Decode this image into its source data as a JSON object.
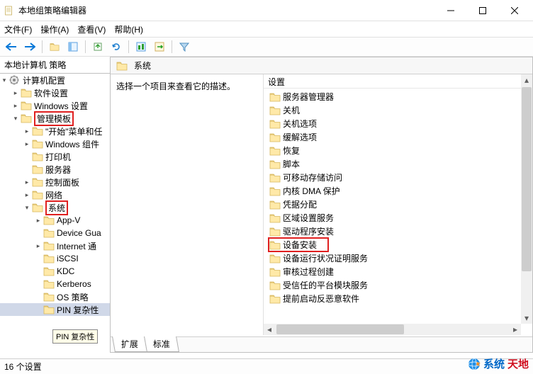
{
  "window": {
    "title": "本地组策略编辑器"
  },
  "menu": {
    "file": "文件(F)",
    "action": "操作(A)",
    "view": "查看(V)",
    "help": "帮助(H)"
  },
  "tree": {
    "root": "本地计算机 策略",
    "computer_config": "计算机配置",
    "software_settings": "软件设置",
    "windows_settings": "Windows 设置",
    "admin_templates": "管理模板",
    "start_menu": "\"开始\"菜单和任",
    "windows_components": "Windows 组件",
    "printer": "打印机",
    "server": "服务器",
    "control_panel": "控制面板",
    "network": "网络",
    "system": "系统",
    "appv": "App-V",
    "device_guard": "Device Gua",
    "internet": "Internet 通",
    "iscsi": "iSCSI",
    "kdc": "KDC",
    "kerberos": "Kerberos",
    "os_policy": "OS 策略",
    "pin_complexity": "PIN 复杂性",
    "tooltip": "PIN 复杂性"
  },
  "header_current": "系统",
  "left_desc": "选择一个项目来查看它的描述。",
  "col_setting": "设置",
  "items": {
    "i0": "服务器管理器",
    "i1": "关机",
    "i2": "关机选项",
    "i3": "缓解选项",
    "i4": "恢复",
    "i5": "脚本",
    "i6": "可移动存储访问",
    "i7": "内核 DMA 保护",
    "i8": "凭据分配",
    "i9": "区域设置服务",
    "i10": "驱动程序安装",
    "i11": "设备安装",
    "i12": "设备运行状况证明服务",
    "i13": "审核过程创建",
    "i14": "受信任的平台模块服务",
    "i15": "提前启动反恶意软件"
  },
  "tabs": {
    "ext": "扩展",
    "std": "标准"
  },
  "status": "16 个设置",
  "watermark": {
    "a": "系统",
    "b": "天地"
  }
}
